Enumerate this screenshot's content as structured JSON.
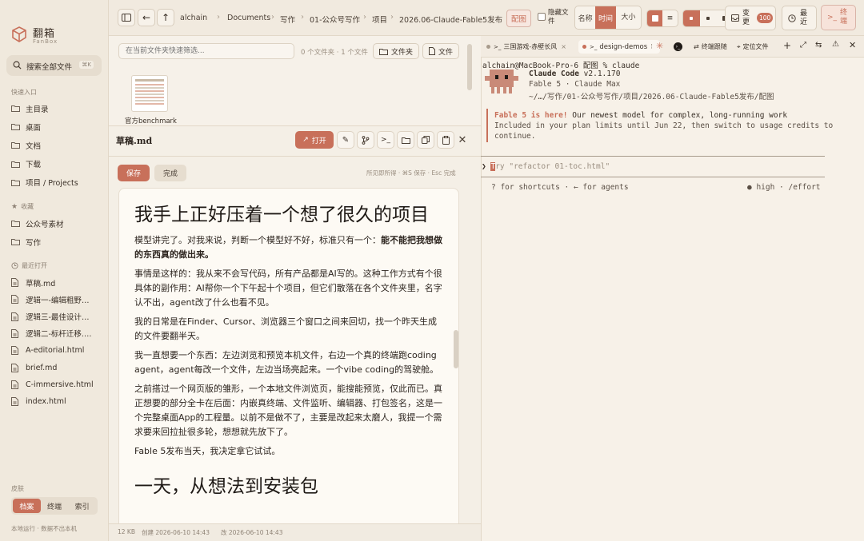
{
  "app": {
    "name": "翻箱",
    "subtitle": "FanBox"
  },
  "sidebar": {
    "search_label": "搜索全部文件",
    "search_shortcut": "⌘K",
    "quick_heading": "快速入口",
    "quick": [
      "主目录",
      "桌面",
      "文档",
      "下载",
      "项目 / Projects"
    ],
    "fav_heading": "收藏",
    "favorites": [
      "公众号素材",
      "写作"
    ],
    "recent_heading": "最近打开",
    "recent": [
      "草稿.md",
      "逻辑一-编辑粗野主...",
      "逻辑三-最佳设计师....",
      "逻辑二-标杆迁移.ht...",
      "A-editorial.html",
      "brief.md",
      "C-immersive.html",
      "index.html"
    ],
    "skin_heading": "皮肤",
    "skins": [
      "档案",
      "终端",
      "索引"
    ],
    "footer": "本地运行 · 数据不出本机"
  },
  "toolbar": {
    "breadcrumb": [
      "alchain",
      "Documents",
      "写作",
      "01-公众号写作",
      "项目",
      "2026.06-Claude-Fable5发布",
      "配图"
    ],
    "hidden_files_label": "隐藏文件",
    "sort_options": [
      "名称",
      "时间",
      "大小"
    ],
    "sort_active": "时间",
    "changes_label": "变更",
    "changes_count": "100",
    "recent_label": "最近",
    "terminal_label": "终端"
  },
  "file_panel": {
    "filter_placeholder": "在当前文件夹快速筛选...",
    "count_text": "0 个文件夹 · 1 个文件",
    "new_folder_label": "文件夹",
    "new_file_label": "文件",
    "thumb_label": "官方benchmark"
  },
  "editor": {
    "filename": "草稿.md",
    "open_label": "打开",
    "save_label": "保存",
    "done_label": "完成",
    "hint": "所见即所得 · ⌘S 保存 · Esc 完成",
    "title": "我手上正好压着一个想了很久的项目",
    "p1_normal": "模型讲完了。对我来说，判断一个模型好不好，标准只有一个：",
    "p1_bold": "能不能把我想做的东西真的做出来。",
    "p2": "事情是这样的：我从来不会写代码，所有产品都是AI写的。这种工作方式有个很具体的副作用：AI帮你一个下午起十个项目，但它们散落在各个文件夹里，名字认不出，agent改了什么也看不见。",
    "p3": "我的日常是在Finder、Cursor、浏览器三个窗口之间来回切，找一个昨天生成的文件要翻半天。",
    "p4": "我一直想要一个东西：左边浏览和预览本机文件，右边一个真的终端跑coding agent，agent每改一个文件，左边当场亮起来。一个vibe coding的驾驶舱。",
    "p5": "之前搭过一个网页版的雏形，一个本地文件浏览页，能搜能预览，仅此而已。真正想要的部分全卡在后面：内嵌真终端、文件监听、编辑器、打包签名，这是一个完整桌面App的工程量。以前不是做不了，主要是改起来太磨人，我提一个需求要来回拉扯很多轮，想想就先放下了。",
    "p6": "Fable 5发布当天，我决定拿它试试。",
    "h2": "一天，从想法到安装包",
    "status_size": "12 KB",
    "status_created": "创建 2026-06-10 14:43",
    "status_modified": "改 2026-06-10 14:43"
  },
  "terminal": {
    "tabs": [
      "三国游戏-赤壁长风",
      "design-demos"
    ],
    "follow_label": "终端跟随",
    "locate_label": "定位文件",
    "prompt": "alchain@MacBook-Pro-6 配图 % claude",
    "cc_name": "Claude Code",
    "cc_version": "v2.1.170",
    "cc_model": "Fable 5 · Claude Max",
    "cc_path": "~/…/写作/01-公众号写作/项目/2026.06-Claude-Fable5发布/配图",
    "notice_bold": "Fable 5 is here!",
    "notice_rest": " Our newest model for complex, long-running work",
    "notice2": "Included in your plan limits until Jun 22, then switch to usage credits to",
    "notice3": "continue.",
    "input_prefix": "❯",
    "input_cursor": "T",
    "input_placeholder": "ry \"refactor 01-toc.html\"",
    "hint_left": "? for shortcuts · ← for agents",
    "hint_right": "● high · /effort"
  },
  "colors": {
    "accent": "#c8705a",
    "panel": "#f6f1e9",
    "sidebar": "#f0e9dd",
    "terminal_bg": "#f7f1e8",
    "mascot": "#c98a78"
  }
}
